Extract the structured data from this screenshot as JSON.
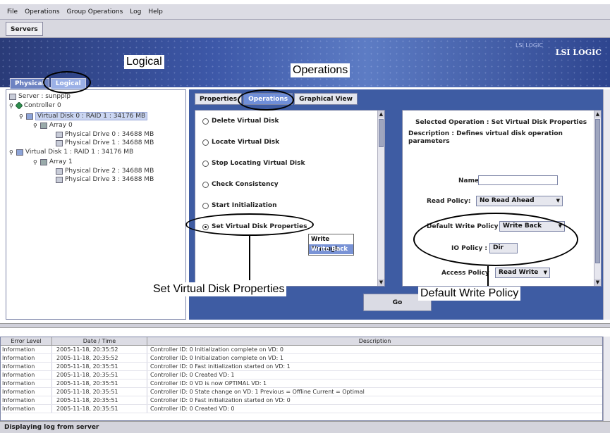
{
  "menu": [
    "File",
    "Operations",
    "Group Operations",
    "Log",
    "Help"
  ],
  "toolbar": {
    "servers_tab": "Servers"
  },
  "banner": {
    "logo": "LSI LOGIC",
    "faded": "LSI LOGIC"
  },
  "main_tabs": [
    "Physical",
    "Logical"
  ],
  "tree": {
    "server": "Server : sunpplp",
    "controller": "Controller 0",
    "vd0": "Virtual Disk 0 : RAID 1 : 34176 MB",
    "array0": "Array 0",
    "pd0": "Physical Drive 0 : 34688 MB",
    "pd1": "Physical Drive 1 : 34688 MB",
    "vd1": "Virtual Disk 1 : RAID 1 : 34176 MB",
    "array1": "Array 1",
    "pd2": "Physical Drive 2 : 34688 MB",
    "pd3": "Physical Drive 3 : 34688 MB"
  },
  "right_tabs": [
    "Properties",
    "Operations",
    "Graphical View"
  ],
  "operations": [
    "Delete Virtual Disk",
    "Locate Virtual Disk",
    "Stop Locating Virtual Disk",
    "Check Consistency",
    "Start Initialization",
    "Set Virtual Disk Properties"
  ],
  "props": {
    "selected": "Selected Operation : Set Virtual Disk Properties",
    "desc1": "Description : Defines virtual disk operation",
    "desc2": "parameters",
    "name_label": "Name :",
    "read_label": "Read Policy:",
    "read_value": "No Read Ahead",
    "write_label": "Default Write Policy :",
    "write_value": "Write Back",
    "io_label": "IO Policy :",
    "io_value": "Dir",
    "access_label": "Access Policy",
    "access_value": "Read Write"
  },
  "write_options": [
    "Write Through",
    "Write Back"
  ],
  "go": "Go",
  "log": {
    "headers": [
      "Error Level",
      "Date / Time",
      "Description"
    ],
    "rows": [
      [
        "Information",
        "2005-11-18, 20:35:52",
        "Controller ID:  0   Initialization complete on VD:  0"
      ],
      [
        "Information",
        "2005-11-18, 20:35:52",
        "Controller ID:  0   Initialization complete on VD:  1"
      ],
      [
        "Information",
        "2005-11-18, 20:35:51",
        "Controller ID:  0   Fast initialization started on VD:  1"
      ],
      [
        "Information",
        "2005-11-18, 20:35:51",
        "Controller ID:  0   Created VD:  1"
      ],
      [
        "Information",
        "2005-11-18, 20:35:51",
        "Controller ID:  0   VD is now OPTIMAL   VD:  1"
      ],
      [
        "Information",
        "2005-11-18, 20:35:51",
        "Controller ID:  0   State change on VD:  1  Previous  =  Offline  Current  =  Optimal"
      ],
      [
        "Information",
        "2005-11-18, 20:35:51",
        "Controller ID:  0   Fast initialization started on VD:  0"
      ],
      [
        "Information",
        "2005-11-18, 20:35:51",
        "Controller ID:  0   Created VD:  0"
      ]
    ]
  },
  "status": "Displaying log from server",
  "callouts": {
    "logical": "Logical",
    "operations": "Operations",
    "set_vd": "Set Virtual Disk Properties",
    "write_policy": "Default Write Policy"
  }
}
